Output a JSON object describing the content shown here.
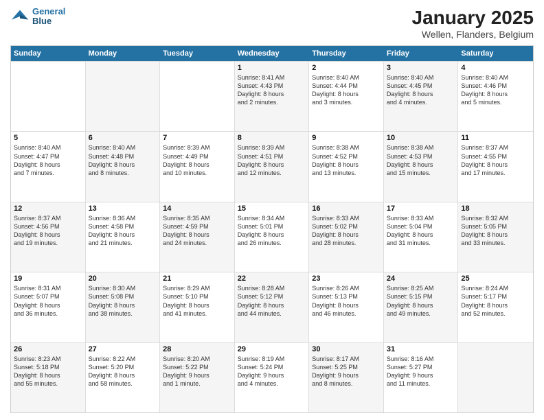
{
  "logo": {
    "line1": "General",
    "line2": "Blue"
  },
  "title": "January 2025",
  "subtitle": "Wellen, Flanders, Belgium",
  "days": [
    "Sunday",
    "Monday",
    "Tuesday",
    "Wednesday",
    "Thursday",
    "Friday",
    "Saturday"
  ],
  "rows": [
    [
      {
        "num": "",
        "lines": [],
        "shaded": false
      },
      {
        "num": "",
        "lines": [],
        "shaded": true
      },
      {
        "num": "",
        "lines": [],
        "shaded": false
      },
      {
        "num": "1",
        "lines": [
          "Sunrise: 8:41 AM",
          "Sunset: 4:43 PM",
          "Daylight: 8 hours",
          "and 2 minutes."
        ],
        "shaded": true
      },
      {
        "num": "2",
        "lines": [
          "Sunrise: 8:40 AM",
          "Sunset: 4:44 PM",
          "Daylight: 8 hours",
          "and 3 minutes."
        ],
        "shaded": false
      },
      {
        "num": "3",
        "lines": [
          "Sunrise: 8:40 AM",
          "Sunset: 4:45 PM",
          "Daylight: 8 hours",
          "and 4 minutes."
        ],
        "shaded": true
      },
      {
        "num": "4",
        "lines": [
          "Sunrise: 8:40 AM",
          "Sunset: 4:46 PM",
          "Daylight: 8 hours",
          "and 5 minutes."
        ],
        "shaded": false
      }
    ],
    [
      {
        "num": "5",
        "lines": [
          "Sunrise: 8:40 AM",
          "Sunset: 4:47 PM",
          "Daylight: 8 hours",
          "and 7 minutes."
        ],
        "shaded": false
      },
      {
        "num": "6",
        "lines": [
          "Sunrise: 8:40 AM",
          "Sunset: 4:48 PM",
          "Daylight: 8 hours",
          "and 8 minutes."
        ],
        "shaded": true
      },
      {
        "num": "7",
        "lines": [
          "Sunrise: 8:39 AM",
          "Sunset: 4:49 PM",
          "Daylight: 8 hours",
          "and 10 minutes."
        ],
        "shaded": false
      },
      {
        "num": "8",
        "lines": [
          "Sunrise: 8:39 AM",
          "Sunset: 4:51 PM",
          "Daylight: 8 hours",
          "and 12 minutes."
        ],
        "shaded": true
      },
      {
        "num": "9",
        "lines": [
          "Sunrise: 8:38 AM",
          "Sunset: 4:52 PM",
          "Daylight: 8 hours",
          "and 13 minutes."
        ],
        "shaded": false
      },
      {
        "num": "10",
        "lines": [
          "Sunrise: 8:38 AM",
          "Sunset: 4:53 PM",
          "Daylight: 8 hours",
          "and 15 minutes."
        ],
        "shaded": true
      },
      {
        "num": "11",
        "lines": [
          "Sunrise: 8:37 AM",
          "Sunset: 4:55 PM",
          "Daylight: 8 hours",
          "and 17 minutes."
        ],
        "shaded": false
      }
    ],
    [
      {
        "num": "12",
        "lines": [
          "Sunrise: 8:37 AM",
          "Sunset: 4:56 PM",
          "Daylight: 8 hours",
          "and 19 minutes."
        ],
        "shaded": true
      },
      {
        "num": "13",
        "lines": [
          "Sunrise: 8:36 AM",
          "Sunset: 4:58 PM",
          "Daylight: 8 hours",
          "and 21 minutes."
        ],
        "shaded": false
      },
      {
        "num": "14",
        "lines": [
          "Sunrise: 8:35 AM",
          "Sunset: 4:59 PM",
          "Daylight: 8 hours",
          "and 24 minutes."
        ],
        "shaded": true
      },
      {
        "num": "15",
        "lines": [
          "Sunrise: 8:34 AM",
          "Sunset: 5:01 PM",
          "Daylight: 8 hours",
          "and 26 minutes."
        ],
        "shaded": false
      },
      {
        "num": "16",
        "lines": [
          "Sunrise: 8:33 AM",
          "Sunset: 5:02 PM",
          "Daylight: 8 hours",
          "and 28 minutes."
        ],
        "shaded": true
      },
      {
        "num": "17",
        "lines": [
          "Sunrise: 8:33 AM",
          "Sunset: 5:04 PM",
          "Daylight: 8 hours",
          "and 31 minutes."
        ],
        "shaded": false
      },
      {
        "num": "18",
        "lines": [
          "Sunrise: 8:32 AM",
          "Sunset: 5:05 PM",
          "Daylight: 8 hours",
          "and 33 minutes."
        ],
        "shaded": true
      }
    ],
    [
      {
        "num": "19",
        "lines": [
          "Sunrise: 8:31 AM",
          "Sunset: 5:07 PM",
          "Daylight: 8 hours",
          "and 36 minutes."
        ],
        "shaded": false
      },
      {
        "num": "20",
        "lines": [
          "Sunrise: 8:30 AM",
          "Sunset: 5:08 PM",
          "Daylight: 8 hours",
          "and 38 minutes."
        ],
        "shaded": true
      },
      {
        "num": "21",
        "lines": [
          "Sunrise: 8:29 AM",
          "Sunset: 5:10 PM",
          "Daylight: 8 hours",
          "and 41 minutes."
        ],
        "shaded": false
      },
      {
        "num": "22",
        "lines": [
          "Sunrise: 8:28 AM",
          "Sunset: 5:12 PM",
          "Daylight: 8 hours",
          "and 44 minutes."
        ],
        "shaded": true
      },
      {
        "num": "23",
        "lines": [
          "Sunrise: 8:26 AM",
          "Sunset: 5:13 PM",
          "Daylight: 8 hours",
          "and 46 minutes."
        ],
        "shaded": false
      },
      {
        "num": "24",
        "lines": [
          "Sunrise: 8:25 AM",
          "Sunset: 5:15 PM",
          "Daylight: 8 hours",
          "and 49 minutes."
        ],
        "shaded": true
      },
      {
        "num": "25",
        "lines": [
          "Sunrise: 8:24 AM",
          "Sunset: 5:17 PM",
          "Daylight: 8 hours",
          "and 52 minutes."
        ],
        "shaded": false
      }
    ],
    [
      {
        "num": "26",
        "lines": [
          "Sunrise: 8:23 AM",
          "Sunset: 5:18 PM",
          "Daylight: 8 hours",
          "and 55 minutes."
        ],
        "shaded": true
      },
      {
        "num": "27",
        "lines": [
          "Sunrise: 8:22 AM",
          "Sunset: 5:20 PM",
          "Daylight: 8 hours",
          "and 58 minutes."
        ],
        "shaded": false
      },
      {
        "num": "28",
        "lines": [
          "Sunrise: 8:20 AM",
          "Sunset: 5:22 PM",
          "Daylight: 9 hours",
          "and 1 minute."
        ],
        "shaded": true
      },
      {
        "num": "29",
        "lines": [
          "Sunrise: 8:19 AM",
          "Sunset: 5:24 PM",
          "Daylight: 9 hours",
          "and 4 minutes."
        ],
        "shaded": false
      },
      {
        "num": "30",
        "lines": [
          "Sunrise: 8:17 AM",
          "Sunset: 5:25 PM",
          "Daylight: 9 hours",
          "and 8 minutes."
        ],
        "shaded": true
      },
      {
        "num": "31",
        "lines": [
          "Sunrise: 8:16 AM",
          "Sunset: 5:27 PM",
          "Daylight: 9 hours",
          "and 11 minutes."
        ],
        "shaded": false
      },
      {
        "num": "",
        "lines": [],
        "shaded": true
      }
    ]
  ]
}
